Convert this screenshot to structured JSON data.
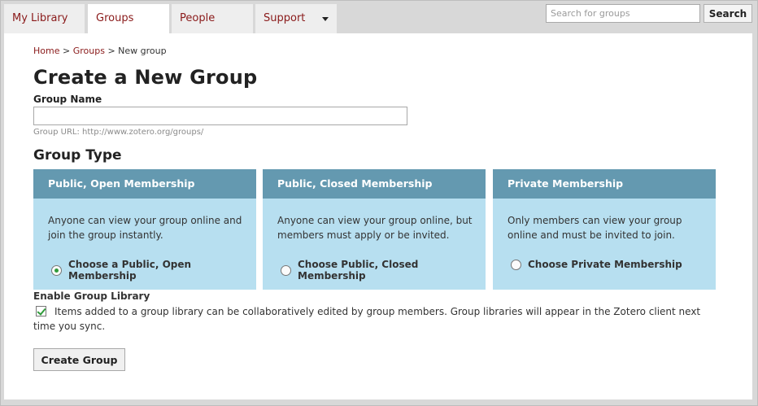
{
  "nav": {
    "tabs": [
      {
        "label": "My Library",
        "active": false
      },
      {
        "label": "Groups",
        "active": true
      },
      {
        "label": "People",
        "active": false
      },
      {
        "label": "Support",
        "active": false
      }
    ]
  },
  "search": {
    "placeholder": "Search for groups",
    "button_label": "Search"
  },
  "breadcrumb": {
    "home": "Home",
    "sep1": ">",
    "groups": "Groups",
    "sep2": ">",
    "current": "New group"
  },
  "page": {
    "title": "Create a New Group",
    "group_name_label": "Group Name",
    "group_url": "Group URL: http://www.zotero.org/groups/",
    "group_type_title": "Group Type"
  },
  "group_types": [
    {
      "header": "Public, Open Membership",
      "description": "Anyone can view your group online and join the group instantly.",
      "choice": "Choose a Public, Open Membership",
      "selected": true
    },
    {
      "header": "Public, Closed Membership",
      "description": "Anyone can view your group online, but members must apply or be invited.",
      "choice": "Choose Public, Closed Membership",
      "selected": false
    },
    {
      "header": "Private Membership",
      "description": "Only members can view your group online and must be invited to join.",
      "choice": "Choose Private Membership",
      "selected": false
    }
  ],
  "library": {
    "label": "Enable Group Library",
    "checked": true,
    "text": "Items added to a group library can be collaboratively edited by group members. Group libraries will appear in the Zotero client next time you sync."
  },
  "actions": {
    "create_label": "Create Group"
  },
  "colors": {
    "nav_link": "#8a1a1a",
    "card_header": "#6499b0",
    "card_body": "#b7dff0",
    "check_green": "#2f9b3a"
  }
}
